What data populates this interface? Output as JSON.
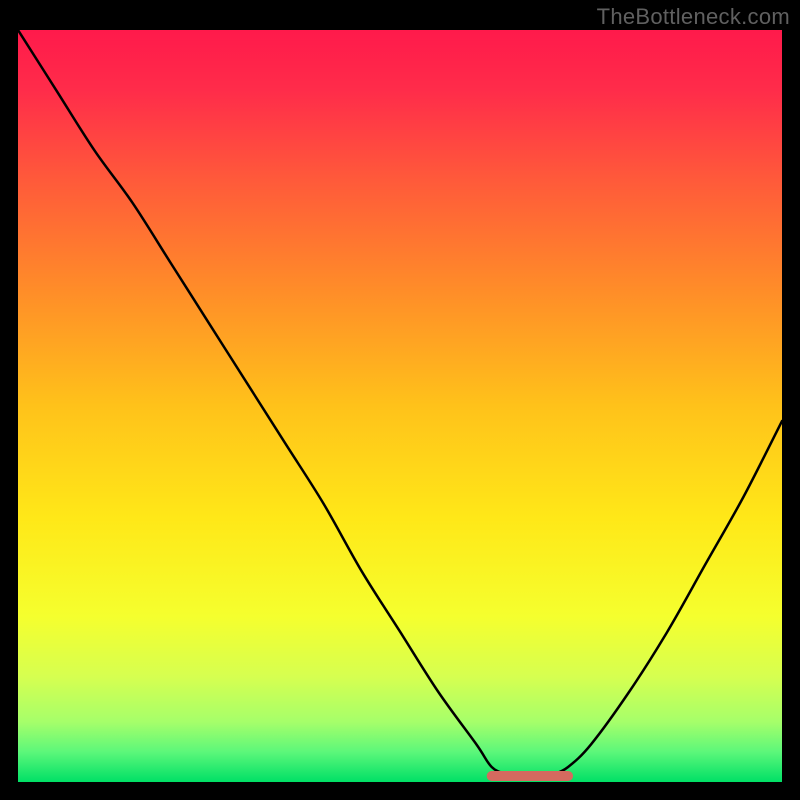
{
  "watermark": "TheBottleneck.com",
  "chart_data": {
    "type": "line",
    "title": "",
    "xlabel": "",
    "ylabel": "",
    "xlim": [
      0,
      100
    ],
    "ylim": [
      0,
      100
    ],
    "grid": false,
    "legend": false,
    "series": [
      {
        "name": "bottleneck-curve",
        "x": [
          0,
          5,
          10,
          15,
          20,
          25,
          30,
          35,
          40,
          45,
          50,
          55,
          60,
          62,
          64,
          66,
          68,
          70,
          72,
          75,
          80,
          85,
          90,
          95,
          100
        ],
        "values": [
          100,
          92,
          84,
          77,
          69,
          61,
          53,
          45,
          37,
          28,
          20,
          12,
          5,
          2,
          1,
          0.5,
          0.5,
          1,
          2,
          5,
          12,
          20,
          29,
          38,
          48
        ]
      }
    ],
    "flat_zone": {
      "x_start": 62,
      "x_end": 72,
      "color": "#d46a5f"
    },
    "gradient_stops": [
      {
        "offset": 0.0,
        "color": "#ff1a4b"
      },
      {
        "offset": 0.08,
        "color": "#ff2c4a"
      },
      {
        "offset": 0.2,
        "color": "#ff5a3a"
      },
      {
        "offset": 0.35,
        "color": "#ff8e28"
      },
      {
        "offset": 0.5,
        "color": "#ffc21a"
      },
      {
        "offset": 0.65,
        "color": "#ffe818"
      },
      {
        "offset": 0.78,
        "color": "#f5ff2e"
      },
      {
        "offset": 0.86,
        "color": "#d6ff50"
      },
      {
        "offset": 0.92,
        "color": "#a6ff6a"
      },
      {
        "offset": 0.96,
        "color": "#5cf77a"
      },
      {
        "offset": 1.0,
        "color": "#00e066"
      }
    ]
  }
}
